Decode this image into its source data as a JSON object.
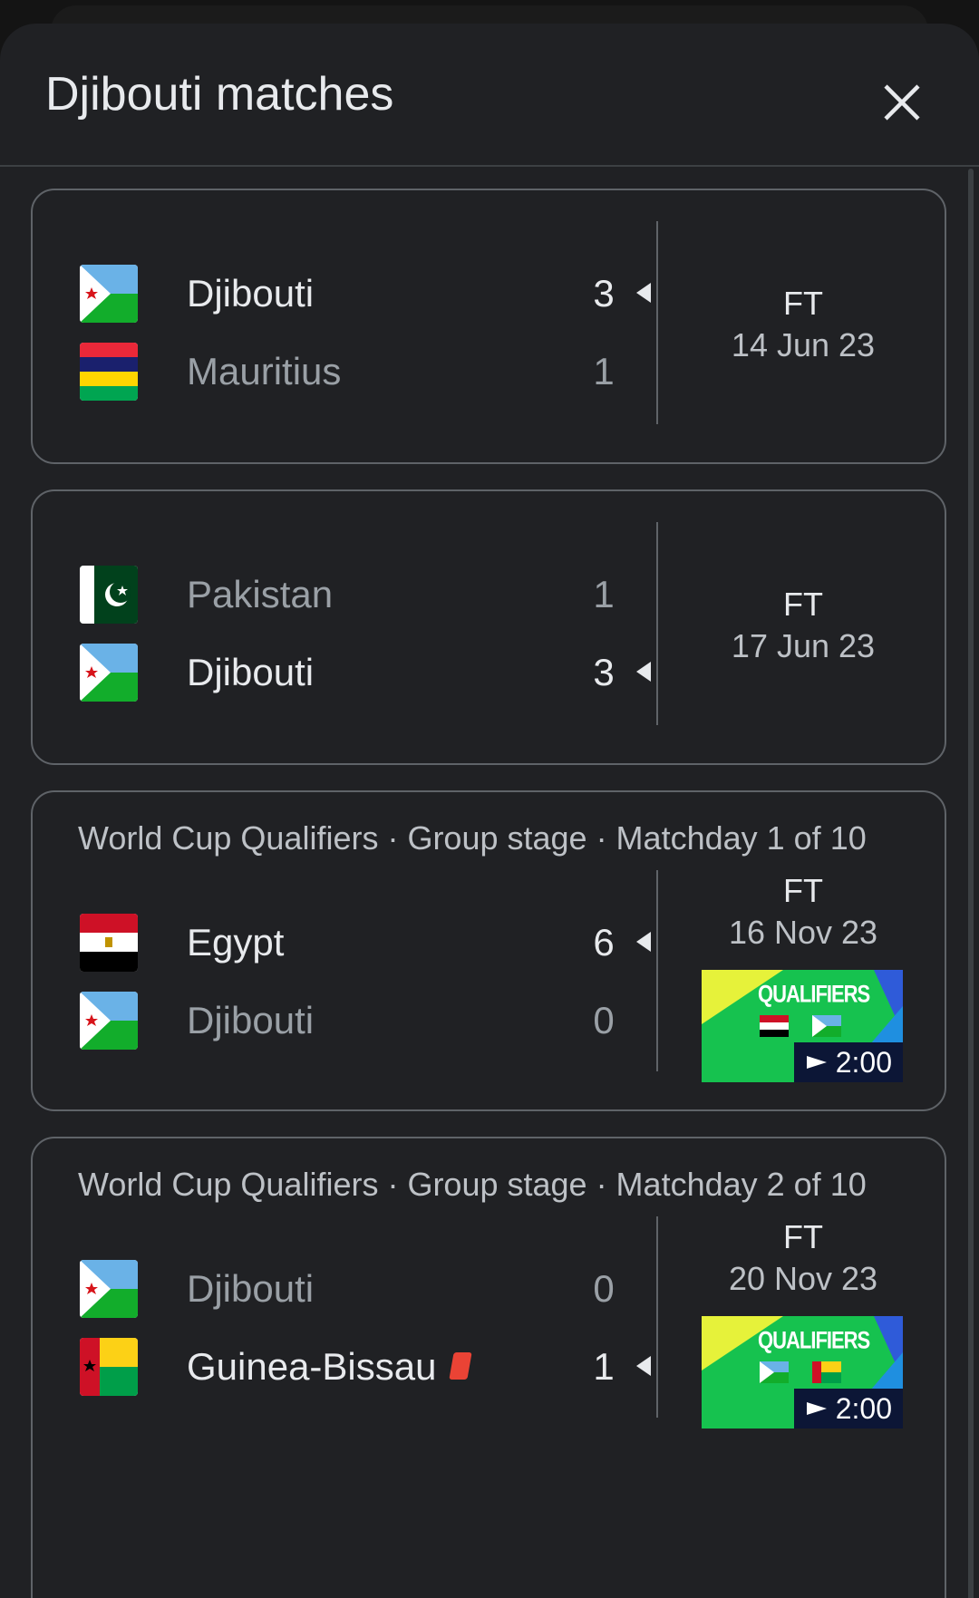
{
  "sheet": {
    "title": "Djibouti matches"
  },
  "colors": {
    "background": "#202124",
    "card_border": "#5f6368",
    "winner_text": "#e8eaed",
    "loser_text": "#9aa0a6",
    "red_card": "#ea4335"
  },
  "matches": [
    {
      "competition": "",
      "status": "FT",
      "date": "14 Jun 23",
      "teams": [
        {
          "name": "Djibouti",
          "score": "3",
          "winner": true,
          "flag": "djibouti-flag"
        },
        {
          "name": "Mauritius",
          "score": "1",
          "winner": false,
          "flag": "mauritius-flag"
        }
      ]
    },
    {
      "competition": "",
      "status": "FT",
      "date": "17 Jun 23",
      "teams": [
        {
          "name": "Pakistan",
          "score": "1",
          "winner": false,
          "flag": "pakistan-flag"
        },
        {
          "name": "Djibouti",
          "score": "3",
          "winner": true,
          "flag": "djibouti-flag"
        }
      ]
    },
    {
      "competition": "World Cup Qualifiers · Group stage · Matchday 1 of 10",
      "status": "FT",
      "date": "16 Nov 23",
      "highlight": {
        "logo": "QUALIFIERS",
        "duration": "2:00",
        "icon": "play-icon"
      },
      "teams": [
        {
          "name": "Egypt",
          "score": "6",
          "winner": true,
          "flag": "egypt-flag"
        },
        {
          "name": "Djibouti",
          "score": "0",
          "winner": false,
          "flag": "djibouti-flag"
        }
      ]
    },
    {
      "competition": "World Cup Qualifiers · Group stage · Matchday 2 of 10",
      "status": "FT",
      "date": "20 Nov 23",
      "highlight": {
        "logo": "QUALIFIERS",
        "duration": "2:00",
        "icon": "play-icon"
      },
      "teams": [
        {
          "name": "Djibouti",
          "score": "0",
          "winner": false,
          "flag": "djibouti-flag"
        },
        {
          "name": "Guinea-Bissau",
          "score": "1",
          "winner": true,
          "flag": "guinea-bissau-flag",
          "red_card": true
        }
      ]
    }
  ]
}
